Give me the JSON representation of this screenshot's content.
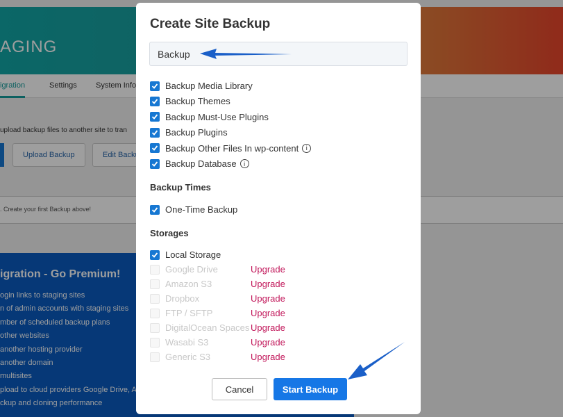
{
  "background": {
    "hero_title": "AGING",
    "tabs": [
      "igration",
      "Settings",
      "System Info"
    ],
    "description": "upload backup files to another site to tran",
    "buttons": [
      "Upload Backup",
      "Edit Backu"
    ],
    "empty_text": ". Create your first Backup above!",
    "promo_title": "igration - Go Premium!",
    "promo_items": [
      "ogin links to staging sites",
      "n of admin accounts with staging sites",
      "mber of scheduled backup plans",
      "other websites",
      "another hosting provider",
      "another domain",
      "multisites",
      "pload to cloud providers Google Drive, A",
      "ckup and cloning performance"
    ]
  },
  "dialog": {
    "title": "Create Site Backup",
    "name_value": "Backup",
    "options": [
      {
        "label": "Backup Media Library",
        "checked": true,
        "info": false
      },
      {
        "label": "Backup Themes",
        "checked": true,
        "info": false
      },
      {
        "label": "Backup Must-Use Plugins",
        "checked": true,
        "info": false
      },
      {
        "label": "Backup Plugins",
        "checked": true,
        "info": false
      },
      {
        "label": "Backup Other Files In wp-content",
        "checked": true,
        "info": true
      },
      {
        "label": "Backup Database",
        "checked": true,
        "info": true
      }
    ],
    "times_heading": "Backup Times",
    "times": [
      {
        "label": "One-Time Backup",
        "checked": true
      }
    ],
    "storages_heading": "Storages",
    "storages": [
      {
        "label": "Local Storage",
        "checked": true,
        "disabled": false,
        "upgrade": ""
      },
      {
        "label": "Google Drive",
        "checked": false,
        "disabled": true,
        "upgrade": "Upgrade"
      },
      {
        "label": "Amazon S3",
        "checked": false,
        "disabled": true,
        "upgrade": "Upgrade"
      },
      {
        "label": "Dropbox",
        "checked": false,
        "disabled": true,
        "upgrade": "Upgrade"
      },
      {
        "label": "FTP / SFTP",
        "checked": false,
        "disabled": true,
        "upgrade": "Upgrade"
      },
      {
        "label": "DigitalOcean Spaces",
        "checked": false,
        "disabled": true,
        "upgrade": "Upgrade"
      },
      {
        "label": "Wasabi S3",
        "checked": false,
        "disabled": true,
        "upgrade": "Upgrade"
      },
      {
        "label": "Generic S3",
        "checked": false,
        "disabled": true,
        "upgrade": "Upgrade"
      }
    ],
    "cancel_label": "Cancel",
    "start_label": "Start Backup",
    "info_icon": "i"
  },
  "colors": {
    "accent": "#1677e6",
    "upgrade": "#c2185b",
    "arrow": "#1a5fc8"
  }
}
